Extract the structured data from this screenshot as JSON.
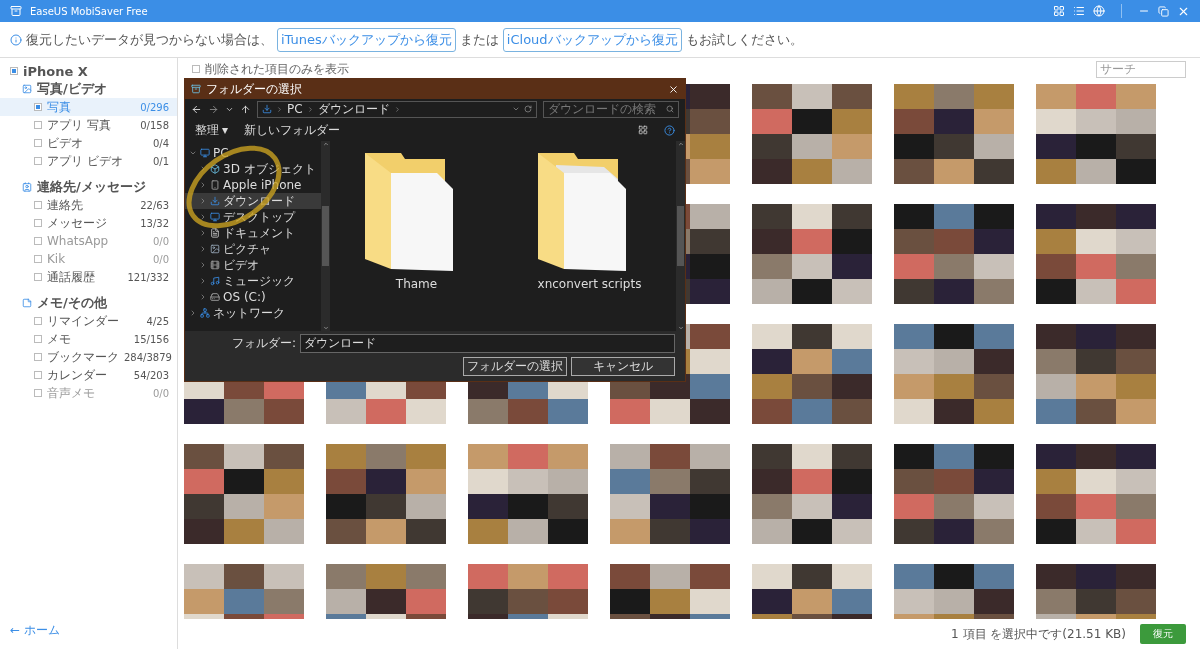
{
  "window": {
    "title": "EaseUS MobiSaver Free"
  },
  "info_bar": {
    "before": "復元したいデータが見つからない場合は、",
    "link_1": "iTunesバックアップから復元",
    "middle": "または",
    "link_2": "iCloudバックアップから復元",
    "after": "もお試しください。"
  },
  "sidebar": {
    "device": {
      "label": "iPhone X",
      "checked": true
    },
    "groups": [
      {
        "kind": "media",
        "label": "写真/ビデオ",
        "items": [
          {
            "label": "写真",
            "count": "0/296",
            "selected": true,
            "checked": true,
            "disabled": false
          },
          {
            "label": "アプリ 写真",
            "count": "0/158",
            "selected": false,
            "checked": false,
            "disabled": false
          },
          {
            "label": "ビデオ",
            "count": "0/4",
            "selected": false,
            "checked": false,
            "disabled": false
          },
          {
            "label": "アプリ ビデオ",
            "count": "0/1",
            "selected": false,
            "checked": false,
            "disabled": false
          }
        ]
      },
      {
        "kind": "contacts",
        "label": "連絡先/メッセージ",
        "items": [
          {
            "label": "連絡先",
            "count": "22/63",
            "selected": false,
            "checked": false,
            "disabled": false
          },
          {
            "label": "メッセージ",
            "count": "13/32",
            "selected": false,
            "checked": false,
            "disabled": false
          },
          {
            "label": "WhatsApp",
            "count": "0/0",
            "selected": false,
            "checked": false,
            "disabled": true
          },
          {
            "label": "Kik",
            "count": "0/0",
            "selected": false,
            "checked": false,
            "disabled": true
          },
          {
            "label": "通話履歴",
            "count": "121/332",
            "selected": false,
            "checked": false,
            "disabled": false
          }
        ]
      },
      {
        "kind": "notes",
        "label": "メモ/その他",
        "items": [
          {
            "label": "リマインダー",
            "count": "4/25",
            "selected": false,
            "checked": false,
            "disabled": false
          },
          {
            "label": "メモ",
            "count": "15/156",
            "selected": false,
            "checked": false,
            "disabled": false
          },
          {
            "label": "ブックマーク",
            "count": "284/3879",
            "selected": false,
            "checked": false,
            "disabled": false
          },
          {
            "label": "カレンダー",
            "count": "54/203",
            "selected": false,
            "checked": false,
            "disabled": false
          },
          {
            "label": "音声メモ",
            "count": "0/0",
            "selected": false,
            "checked": false,
            "disabled": true
          }
        ]
      }
    ],
    "home": "← ホーム"
  },
  "filter": {
    "label": "削除された項目のみを表示",
    "checked": false
  },
  "search": {
    "placeholder": "サーチ"
  },
  "status": {
    "text": "1 項目 を選択中です(21.51 KB)",
    "button": "復元"
  },
  "dialog": {
    "title": "フォルダーの選択",
    "path": [
      "PC",
      "ダウンロード"
    ],
    "search_placeholder": "ダウンロードの検索",
    "organize": "整理 ▾",
    "new_folder": "新しいフォルダー",
    "tree": [
      {
        "kind": "computer",
        "label": "PC",
        "expanded": true,
        "selected": false,
        "children": [
          {
            "kind": "cube",
            "label": "3D オブジェクト",
            "selected": false
          },
          {
            "kind": "phone",
            "label": "Apple iPhone",
            "selected": false
          },
          {
            "kind": "download",
            "label": "ダウンロード",
            "selected": true
          },
          {
            "kind": "desktop",
            "label": "デスクトップ",
            "selected": false
          },
          {
            "kind": "document",
            "label": "ドキュメント",
            "selected": false
          },
          {
            "kind": "picture",
            "label": "ピクチャ",
            "selected": false
          },
          {
            "kind": "video",
            "label": "ビデオ",
            "selected": false
          },
          {
            "kind": "music",
            "label": "ミュージック",
            "selected": false
          },
          {
            "kind": "drive",
            "label": "OS (C:)",
            "selected": false
          }
        ]
      },
      {
        "kind": "network",
        "label": "ネットワーク",
        "expanded": false,
        "selected": false
      }
    ],
    "folders": [
      {
        "label": "Thame",
        "kind": "single"
      },
      {
        "label": "xnconvert scripts",
        "kind": "multi"
      }
    ],
    "folder_label": "フォルダー:",
    "folder_value": "ダウンロード",
    "select_button": "フォルダーの選択",
    "cancel_button": "キャンセル"
  }
}
